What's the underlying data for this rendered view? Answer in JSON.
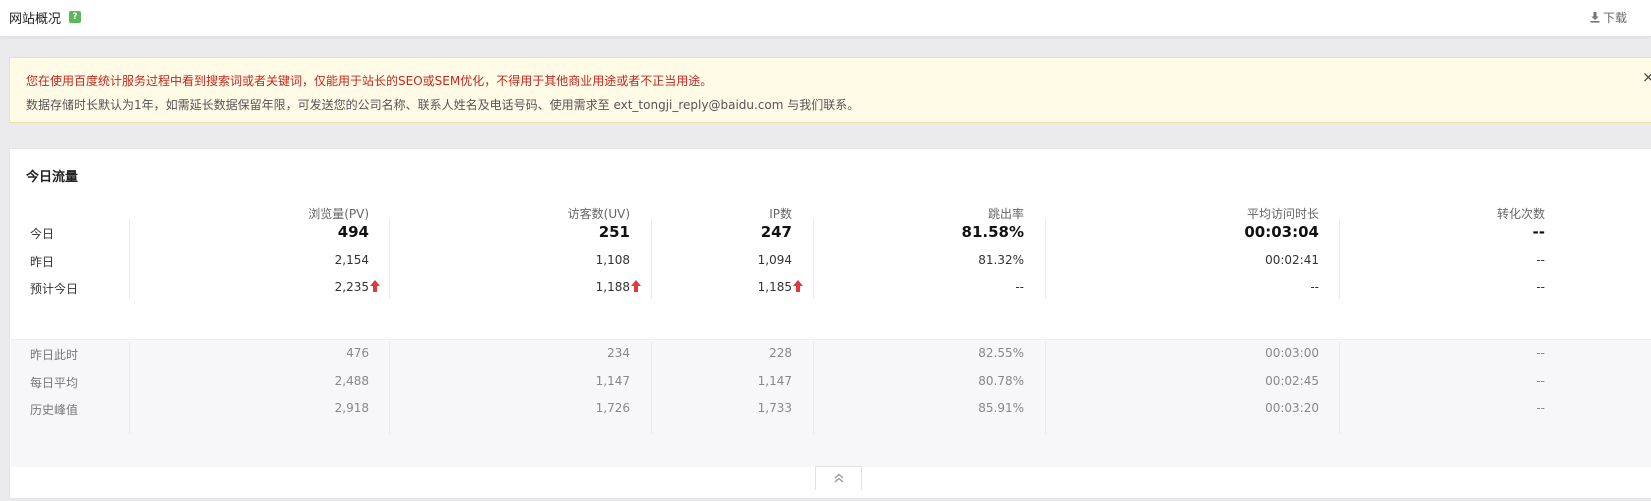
{
  "header": {
    "title": "网站概况",
    "help_icon": "?",
    "download_label": "下载"
  },
  "notice": {
    "line1": "您在使用百度统计服务过程中看到搜索词或者关键词，仅能用于站长的SEO或SEM优化，不得用于其他商业用途或者不正当用途。",
    "line2": "数据存储时长默认为1年，如需延长数据保留年限，可发送您的公司名称、联系人姓名及电话号码、使用需求至 ext_tongji_reply@baidu.com 与我们联系。",
    "close": "×"
  },
  "traffic": {
    "title": "今日流量",
    "columns": [
      "浏览量(PV)",
      "访客数(UV)",
      "IP数",
      "跳出率",
      "平均访问时长",
      "转化次数"
    ],
    "rows_top": [
      {
        "label": "今日",
        "values": [
          "494",
          "251",
          "247",
          "81.58%",
          "00:03:04",
          "--"
        ],
        "arrows": [
          false,
          false,
          false,
          false,
          false,
          false
        ]
      },
      {
        "label": "昨日",
        "values": [
          "2,154",
          "1,108",
          "1,094",
          "81.32%",
          "00:02:41",
          "--"
        ],
        "arrows": [
          false,
          false,
          false,
          false,
          false,
          false
        ]
      },
      {
        "label": "预计今日",
        "values": [
          "2,235",
          "1,188",
          "1,185",
          "--",
          "--",
          "--"
        ],
        "arrows": [
          true,
          true,
          true,
          false,
          false,
          false
        ]
      }
    ],
    "rows_bottom": [
      {
        "label": "昨日此时",
        "values": [
          "476",
          "234",
          "228",
          "82.55%",
          "00:03:00",
          "--"
        ]
      },
      {
        "label": "每日平均",
        "values": [
          "2,488",
          "1,147",
          "1,147",
          "80.78%",
          "00:02:45",
          "--"
        ]
      },
      {
        "label": "历史峰值",
        "values": [
          "2,918",
          "1,726",
          "1,733",
          "85.91%",
          "00:03:20",
          "--"
        ]
      }
    ]
  },
  "colors": {
    "accent_red": "#e0393e",
    "notice_red": "#c3271f",
    "help_green": "#5cb85c"
  },
  "icons": {
    "download": "download-icon",
    "up_arrow": "arrow-up-icon",
    "collapse": "double-chevron-up-icon",
    "close": "close-icon",
    "help": "help-icon"
  }
}
